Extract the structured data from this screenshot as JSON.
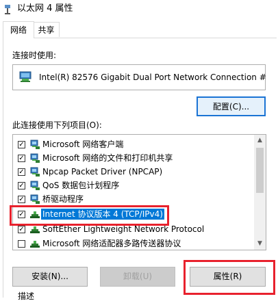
{
  "window": {
    "title": "以太网 4 属性"
  },
  "tabs": [
    {
      "label": "网络",
      "active": true
    },
    {
      "label": "共享",
      "active": false
    }
  ],
  "connect_using": {
    "label": "连接时使用:",
    "adapter": "Intel(R) 82576 Gigabit Dual Port Network Connection #",
    "adapter_icon": "network-adapter-icon",
    "configure_button": "配置(C)..."
  },
  "items_section": {
    "label": "此连接使用下列项目(O):",
    "items": [
      {
        "label": "Microsoft 网络客户端",
        "checked": true,
        "icon": "network-client-icon",
        "selected": false
      },
      {
        "label": "Microsoft 网络的文件和打印机共享",
        "checked": true,
        "icon": "network-service-icon",
        "selected": false
      },
      {
        "label": "Npcap Packet Driver (NPCAP)",
        "checked": true,
        "icon": "network-service-icon",
        "selected": false
      },
      {
        "label": "QoS 数据包计划程序",
        "checked": true,
        "icon": "network-service-icon",
        "selected": false
      },
      {
        "label": "桥驱动程序",
        "checked": true,
        "icon": "network-service-icon",
        "selected": false
      },
      {
        "label": "Internet 协议版本 4 (TCP/IPv4)",
        "checked": true,
        "icon": "protocol-icon",
        "selected": true
      },
      {
        "label": "SoftEther Lightweight Network Protocol",
        "checked": true,
        "icon": "protocol-icon",
        "selected": false
      },
      {
        "label": "Microsoft 网络适配器多路传送器协议",
        "checked": false,
        "icon": "protocol-icon",
        "selected": false
      }
    ]
  },
  "buttons": {
    "install": "安装(N)...",
    "uninstall": "卸载(U)",
    "properties": "属性(R)"
  },
  "description": {
    "label": "描述"
  },
  "colors": {
    "highlight": "#e8212d",
    "selection": "#0078d7",
    "focus_border": "#1a73d4"
  }
}
